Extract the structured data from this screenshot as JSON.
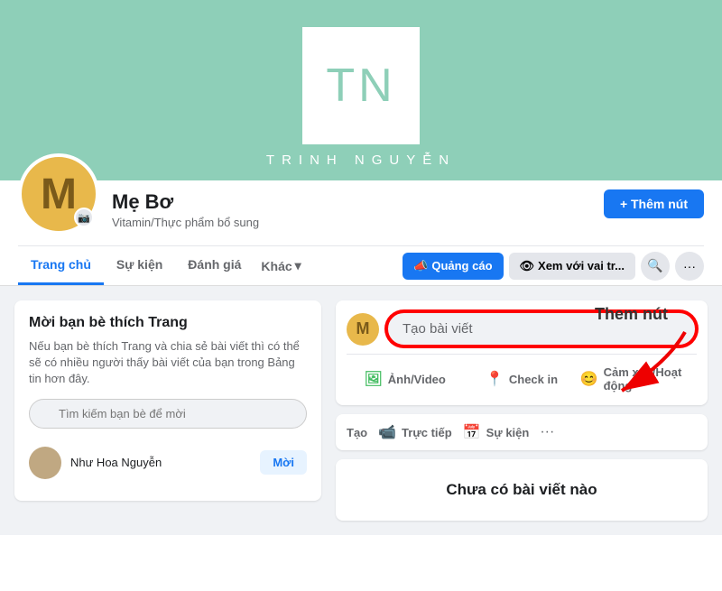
{
  "cover": {
    "letters": "TN",
    "name": "TRINH NGUYỄN",
    "bg_color": "#8ecfb8"
  },
  "profile": {
    "avatar_letter": "M",
    "name": "Mẹ Bơ",
    "category": "Vitamin/Thực phẩm bổ sung",
    "add_button_label": "+ Thêm nút"
  },
  "nav": {
    "tabs": [
      {
        "label": "Trang chủ",
        "active": true
      },
      {
        "label": "Sự kiện",
        "active": false
      },
      {
        "label": "Đánh giá",
        "active": false
      },
      {
        "label": "Khác",
        "active": false,
        "dropdown": true
      }
    ],
    "actions": [
      {
        "label": "Quảng cáo",
        "type": "primary",
        "icon": "📣"
      },
      {
        "label": "Xem với vai tr...",
        "type": "secondary",
        "icon": "👁"
      }
    ],
    "search_icon": "🔍",
    "more_icon": "···"
  },
  "invite_card": {
    "title": "Mời bạn bè thích Trang",
    "description": "Nếu bạn bè thích Trang và chia sẻ bài viết thì có thể sẽ có nhiều người thấy bài viết của bạn trong Bảng tin hơn đây.",
    "search_placeholder": "Tìm kiếm bạn bè để mời",
    "friend": {
      "name": "Như Hoa Nguyễn",
      "invite_label": "Mời"
    }
  },
  "create_post": {
    "placeholder": "Tạo bài viết",
    "actions": [
      {
        "label": "Ảnh/Video",
        "icon": "🖼",
        "color": "#45bd62"
      },
      {
        "label": "Check in",
        "icon": "📍",
        "color": "#f5533d"
      },
      {
        "label": "Cảm xúc/Hoạt động",
        "icon": "😊",
        "color": "#f7b928"
      }
    ]
  },
  "extra_actions": {
    "create_label": "Tạo",
    "live_label": "Trực tiếp",
    "live_icon": "📹",
    "event_label": "Sự kiện",
    "event_icon": "📅"
  },
  "no_posts": {
    "text": "Chưa có bài viết nào"
  },
  "annotation": {
    "label": "Them nút"
  }
}
